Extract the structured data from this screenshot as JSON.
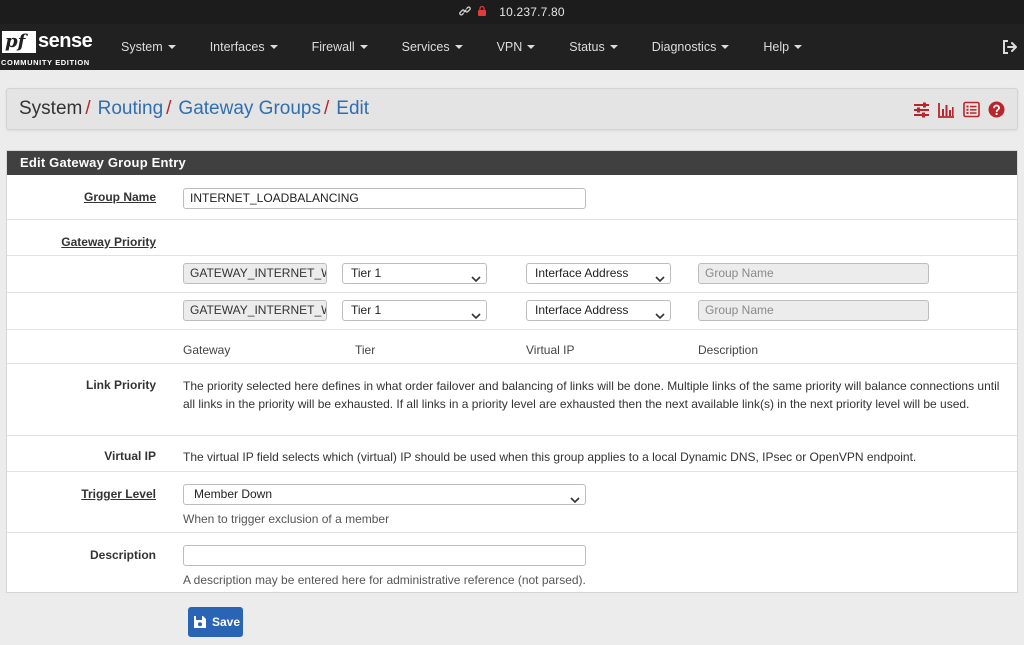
{
  "browser": {
    "url": "10.237.7.80"
  },
  "logo": {
    "pf": "pf",
    "sense": "sense",
    "edition": "COMMUNITY EDITION"
  },
  "nav": {
    "items": [
      {
        "label": "System"
      },
      {
        "label": "Interfaces"
      },
      {
        "label": "Firewall"
      },
      {
        "label": "Services"
      },
      {
        "label": "VPN"
      },
      {
        "label": "Status"
      },
      {
        "label": "Diagnostics"
      },
      {
        "label": "Help"
      }
    ]
  },
  "breadcrumb": {
    "system": "System",
    "routing": "Routing",
    "gateway_groups": "Gateway Groups",
    "edit": "Edit",
    "sep": "/"
  },
  "panel": {
    "title": "Edit Gateway Group Entry"
  },
  "form": {
    "group_name": {
      "label": "Group Name",
      "value": "INTERNET_LOADBALANCING"
    },
    "gateway_priority": {
      "label": "Gateway Priority",
      "rows": [
        {
          "gateway": "GATEWAY_INTERNET_W",
          "tier": "Tier 1",
          "vip": "Interface Address",
          "desc_placeholder": "Group Name"
        },
        {
          "gateway": "GATEWAY_INTERNET_W",
          "tier": "Tier 1",
          "vip": "Interface Address",
          "desc_placeholder": "Group Name"
        }
      ],
      "columns": {
        "gateway": "Gateway",
        "tier": "Tier",
        "vip": "Virtual IP",
        "description": "Description"
      }
    },
    "link_priority": {
      "label": "Link Priority",
      "help": "The priority selected here defines in what order failover and balancing of links will be done. Multiple links of the same priority will balance connections until all links in the priority will be exhausted. If all links in a priority level are exhausted then the next available link(s) in the next priority level will be used."
    },
    "virtual_ip": {
      "label": "Virtual IP",
      "help": "The virtual IP field selects which (virtual) IP should be used when this group applies to a local Dynamic DNS, IPsec or OpenVPN endpoint."
    },
    "trigger_level": {
      "label": "Trigger Level",
      "value": "Member Down",
      "hint": "When to trigger exclusion of a member"
    },
    "description": {
      "label": "Description",
      "value": "",
      "hint": "A description may be entered here for administrative reference (not parsed)."
    }
  },
  "save_label": "Save",
  "colors": {
    "navbar": "#212121",
    "link": "#2f6fb0",
    "accent": "#b9252a",
    "button": "#2a64b5",
    "panel_head": "#404040"
  }
}
